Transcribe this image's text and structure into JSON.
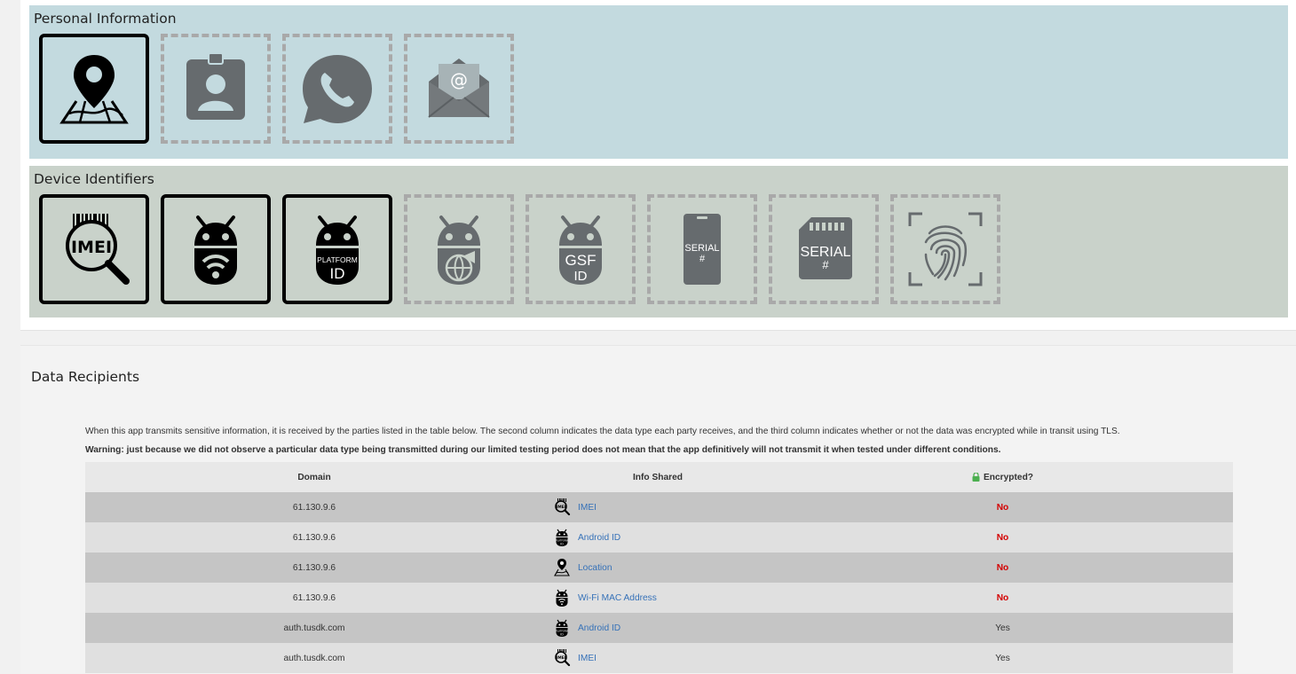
{
  "personal": {
    "title": "Personal Information",
    "icons": [
      {
        "name": "location",
        "state": "detected"
      },
      {
        "name": "contacts",
        "state": "not-detected"
      },
      {
        "name": "phone",
        "state": "not-detected"
      },
      {
        "name": "email",
        "state": "not-detected"
      }
    ]
  },
  "device": {
    "title": "Device Identifiers",
    "icons": [
      {
        "name": "imei",
        "state": "detected",
        "label": "IMEI"
      },
      {
        "name": "wifi-mac",
        "state": "detected"
      },
      {
        "name": "android-id",
        "state": "detected",
        "label_top": "PLATFORM",
        "label_bottom": "ID"
      },
      {
        "name": "advertising-id",
        "state": "not-detected"
      },
      {
        "name": "gsf-id",
        "state": "not-detected",
        "label_top": "GSF",
        "label_bottom": "ID"
      },
      {
        "name": "phone-serial",
        "state": "not-detected",
        "label_top": "SERIAL",
        "label_bottom": "#"
      },
      {
        "name": "sim-serial",
        "state": "not-detected",
        "label_top": "SERIAL",
        "label_bottom": "#"
      },
      {
        "name": "fingerprint",
        "state": "not-detected"
      }
    ]
  },
  "recipients": {
    "title": "Data Recipients",
    "intro": "When this app transmits sensitive information, it is received by the parties listed in the table below. The second column indicates the data type each party receives, and the third column indicates whether or not the data was encrypted while in transit using TLS.",
    "warning": "Warning: just because we did not observe a particular data type being transmitted during our limited testing period does not mean that the app definitively will not transmit it when tested under different conditions.",
    "headers": {
      "domain": "Domain",
      "info": "Info Shared",
      "encrypted": "Encrypted?"
    },
    "rows": [
      {
        "domain": "61.130.9.6",
        "info": "IMEI",
        "icon": "imei-icon",
        "encrypted": "No"
      },
      {
        "domain": "61.130.9.6",
        "info": "Android ID",
        "icon": "android-id-icon",
        "encrypted": "No"
      },
      {
        "domain": "61.130.9.6",
        "info": "Location",
        "icon": "location-icon",
        "encrypted": "No"
      },
      {
        "domain": "61.130.9.6",
        "info": "Wi-Fi MAC Address",
        "icon": "wifi-mac-icon",
        "encrypted": "No"
      },
      {
        "domain": "auth.tusdk.com",
        "info": "Android ID",
        "icon": "android-id-icon",
        "encrypted": "Yes"
      },
      {
        "domain": "auth.tusdk.com",
        "info": "IMEI",
        "icon": "imei-icon",
        "encrypted": "Yes"
      }
    ]
  },
  "colors": {
    "detected": "#000000",
    "not_detected": "#6b6f72",
    "no": "#d40000",
    "link": "#3571b8",
    "lock": "#4caf50"
  }
}
